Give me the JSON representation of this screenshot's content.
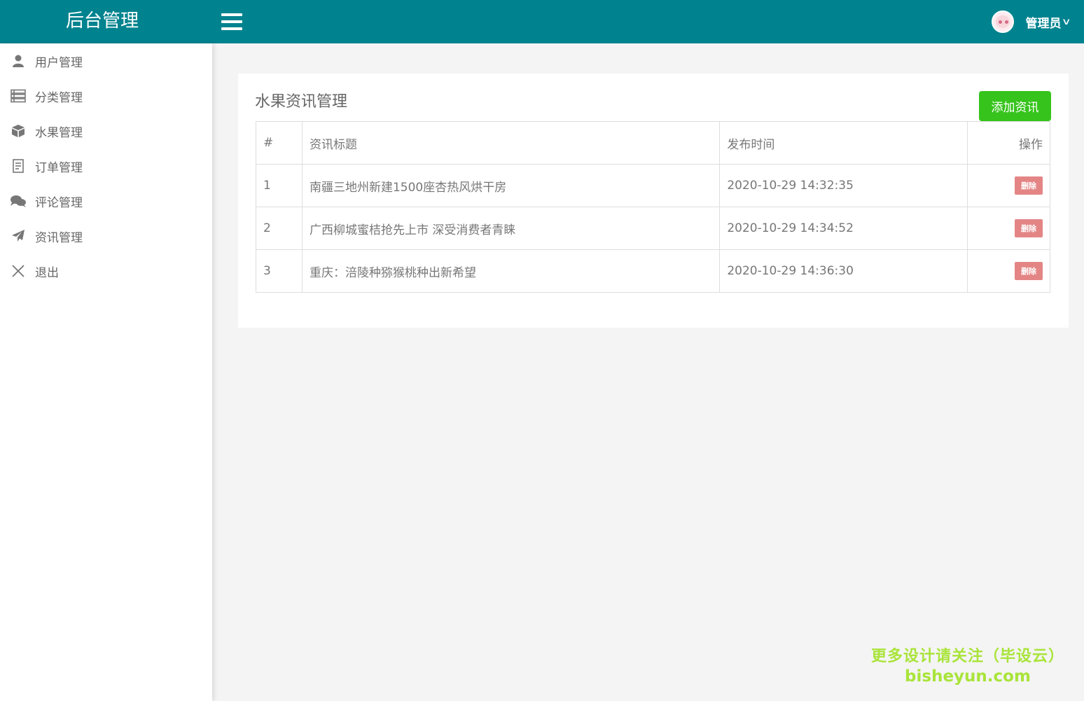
{
  "header": {
    "brand": "后台管理",
    "user_name": "管理员"
  },
  "sidebar": {
    "items": [
      {
        "label": "用户管理",
        "icon": "user-icon"
      },
      {
        "label": "分类管理",
        "icon": "list-icon"
      },
      {
        "label": "水果管理",
        "icon": "cube-icon"
      },
      {
        "label": "订单管理",
        "icon": "receipt-icon"
      },
      {
        "label": "评论管理",
        "icon": "comments-icon"
      },
      {
        "label": "资讯管理",
        "icon": "paper-plane-icon"
      },
      {
        "label": "退出",
        "icon": "close-icon"
      }
    ]
  },
  "main": {
    "title": "水果资讯管理",
    "add_button": "添加资讯",
    "table": {
      "headers": [
        "#",
        "资讯标题",
        "发布时间",
        "操作"
      ],
      "rows": [
        {
          "index": "1",
          "title": "南疆三地州新建1500座杏热风烘干房",
          "time": "2020-10-29 14:32:35",
          "action": "删除"
        },
        {
          "index": "2",
          "title": "广西柳城蜜桔抢先上市 深受消费者青睐",
          "time": "2020-10-29 14:34:52",
          "action": "删除"
        },
        {
          "index": "3",
          "title": "重庆：涪陵种猕猴桃种出新希望",
          "time": "2020-10-29 14:36:30",
          "action": "删除"
        }
      ]
    }
  },
  "watermark": {
    "line1": "更多设计请关注（毕设云）",
    "line2": "bisheyun.com"
  },
  "colors": {
    "topbar": "#00838f",
    "add_button": "#36c41c",
    "delete_button": "#e48585",
    "watermark": "#a9e43a"
  }
}
